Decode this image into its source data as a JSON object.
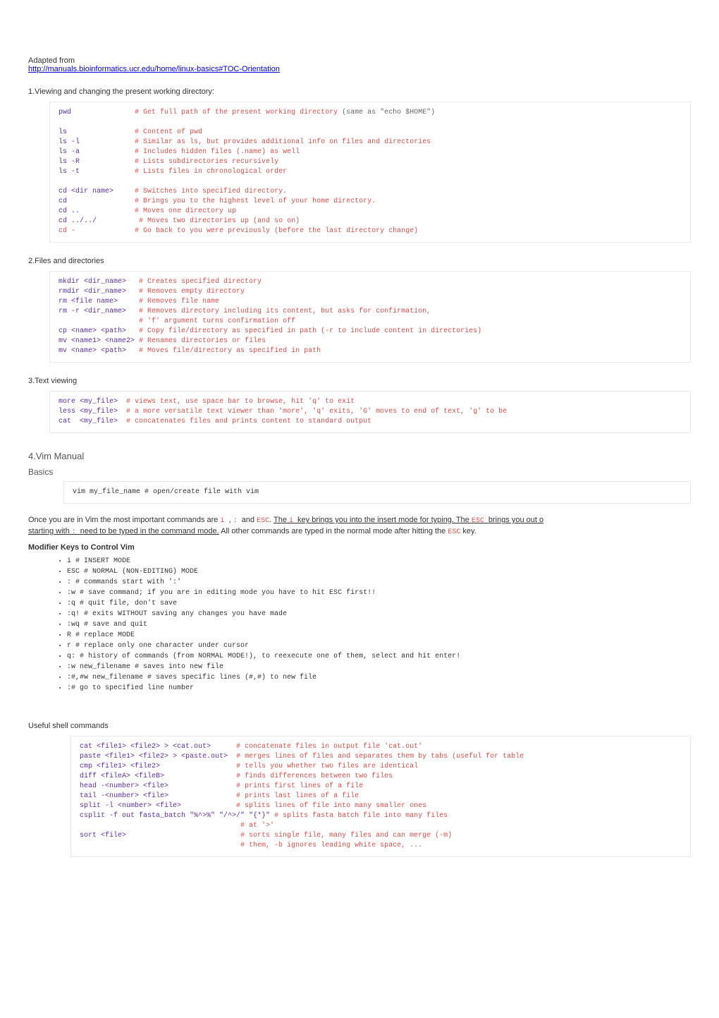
{
  "intro": {
    "adapted": "Adapted from",
    "url": "http://manuals.bioinformatics.ucr.edu/home/linux-basics#TOC-Orientation"
  },
  "sections": {
    "s1": {
      "title": "1.Viewing and changing the present working directory:",
      "lines": {
        "pwd_cmd": "pwd",
        "pwd_c": "# Get full path of the present working directory",
        "pwd_c2": "(same as \"echo $HOME\")",
        "ls_cmd": "ls",
        "ls_c": "# Content of pwd",
        "lsl_cmd": "ls -l",
        "lsl_c": "# Similar as ls, but provides additional info on files and directories",
        "lsa_cmd": "ls -a",
        "lsa_c": "# Includes hidden files (.name) as well",
        "lsR_cmd": "ls -R",
        "lsR_c": "# Lists subdirectories recursively",
        "lst_cmd": "ls -t",
        "lst_c": "# Lists files in chronological order",
        "cdd_cmd": "cd <dir name>",
        "cdd_c": "# Switches into specified directory.",
        "cd_cmd": "cd",
        "cd_c": "# Brings you to the highest level of your home directory.",
        "cdu_cmd": "cd ..",
        "cdu_c": "# Moves one directory up",
        "cdu2_cmd": "cd ../../",
        "cdu2_c": "# Moves two directories up (and so on)",
        "cdm_cmd": "cd -",
        "cdm_c": "# Go back to you were previously (before the last directory change)"
      }
    },
    "s2": {
      "title": "2.Files and directories",
      "lines": {
        "mkdir_cmd": "mkdir <dir_name>",
        "mkdir_c": "# Creates specified directory",
        "rmdir_cmd": "rmdir <dir_name>",
        "rmdir_c": "# Removes empty directory",
        "rm_cmd": "rm <file name>",
        "rm_c": "# Removes file name",
        "rmr_cmd": "rm -r <dir_name>",
        "rmr_c": "# Removes directory including its content, but asks for confirmation,",
        "rmr_c2": "# 'f' argument turns confirmation off",
        "cp_cmd": "cp <name> <path>",
        "cp_c": "# Copy file/directory as specified in path (-r to include content in directories)",
        "mv1_cmd": "mv <name1> <name2>",
        "mv1_c": "# Renames directories or files",
        "mv2_cmd": "mv <name> <path>",
        "mv2_c": "# Moves file/directory as specified in path"
      }
    },
    "s3": {
      "title": "3.Text viewing",
      "lines": {
        "more_cmd": "more <my_file>",
        "more_c": "# views text, use space bar to browse, hit 'q' to exit",
        "less_cmd": "less <my_file>",
        "less_c": "# a more versatile text viewer than 'more', 'q' exits, 'G' moves to end of text, 'g' to be",
        "cat_cmd": "cat  <my_file>",
        "cat_c": "# concatenates files and prints content to standard output"
      }
    },
    "s4": {
      "h2": "4.Vim Manual",
      "h3": "Basics",
      "code_line": "vim my_file_name # open/create file with vim",
      "para_before": "Once you are in Vim the most important commands are ",
      "i_kw": " i ",
      "comma": ", ",
      "colon_kw": " : ",
      "and": " and ",
      "esc_kw": "ESC",
      "dot1": ". ",
      "u1": "The ",
      "i_kw2": " i ",
      "u2": " key brings you into the insert mode for typing. The ",
      "esc_kw2": " ESC ",
      "u3": "brings you out o",
      "u4": "starting with ",
      "colon_kw2": " : ",
      "u5": " need to be typed in the command mode.",
      "after": " All other commands are typed in the normal mode after hitting the ",
      "esc_kw3": "ESC",
      "after2": " key.",
      "modifier_title": "Modifier Keys to Control Vim",
      "bullets": [
        "i # INSERT MODE",
        "ESC # NORMAL (NON-EDITING) MODE",
        ": # commands start with ':'",
        ":w # save command; if you are in editing mode you have to hit ESC first!!",
        ":q # quit file, don't save",
        ":q! # exits WITHOUT saving any changes you have made",
        ":wq # save and quit",
        "R # replace MODE",
        "r # replace only one character under cursor",
        "q: # history of commands (from NORMAL MODE!), to reexecute one of them, select and hit enter!",
        ":w new_filename # saves into new file",
        ":#,#w new_filename # saves specific lines (#,#) to new file",
        ":# go to specified line number"
      ]
    },
    "s5": {
      "title": "Useful shell commands",
      "lines": {
        "cat_cmd": "cat <file1> <file2> > <cat.out>",
        "cat_c": "# concatenate files in output file 'cat.out'",
        "paste_cmd": "paste <file1> <file2> > <paste.out>",
        "paste_c": "# merges lines of files and separates them by tabs (useful for table",
        "cmp_cmd": "cmp <file1> <file2>",
        "cmp_c": "# tells you whether two files are identical",
        "diff_cmd": "diff <fileA> <fileB>",
        "diff_c": "# finds differences between two files",
        "head_cmd": "head -<number> <file>",
        "head_c": "# prints first lines of a file",
        "tail_cmd": "tail -<number> <file>",
        "tail_c": "# prints last lines of a file",
        "split_cmd": "split -l <number> <file>",
        "split_c": "# splits lines of file into many smaller ones",
        "csplit_cmd": "csplit -f out fasta_batch \"%^>%\" \"/^>/\" \"{*}\"",
        "csplit_c": "# splits fasta batch file into many files",
        "at_c": "# at '>'",
        "sort_cmd": "sort <file>",
        "sort_c": "# sorts single file, many files and can merge (-m)",
        "sort_c2": "# them, -b ignores leading white space, ..."
      }
    }
  }
}
